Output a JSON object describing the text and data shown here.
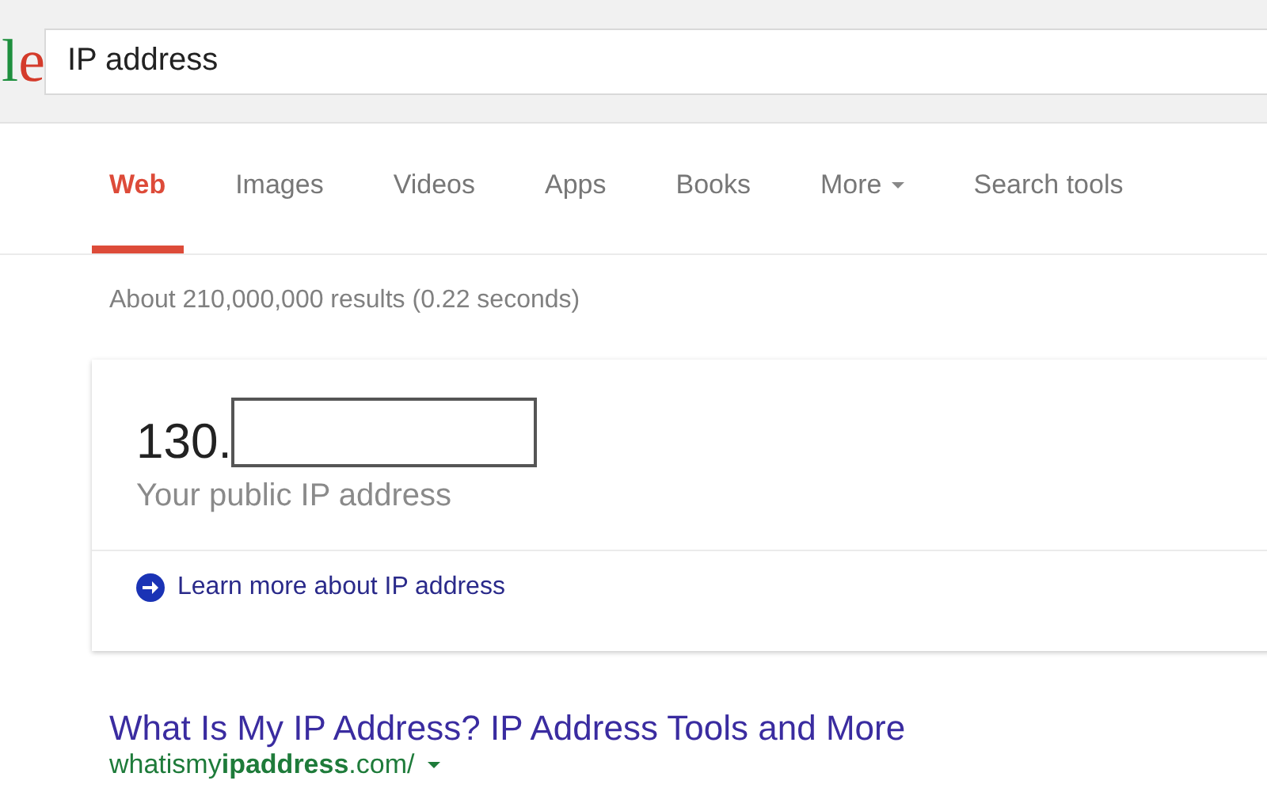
{
  "logo": {
    "letters": [
      {
        "text": "l",
        "color": "#1e8f3e"
      },
      {
        "text": "e",
        "color": "#d43b2b"
      }
    ]
  },
  "search": {
    "value": "IP address"
  },
  "tabs": [
    {
      "label": "Web",
      "selected": true,
      "kind": "plain"
    },
    {
      "label": "Images",
      "selected": false,
      "kind": "plain"
    },
    {
      "label": "Videos",
      "selected": false,
      "kind": "plain"
    },
    {
      "label": "Apps",
      "selected": false,
      "kind": "plain"
    },
    {
      "label": "Books",
      "selected": false,
      "kind": "plain"
    },
    {
      "label": "More",
      "selected": false,
      "kind": "dropdown"
    },
    {
      "label": "Search tools",
      "selected": false,
      "kind": "plain"
    }
  ],
  "result_stats": "About 210,000,000 results (0.22 seconds)",
  "answer_card": {
    "ip_prefix": "130.",
    "caption": "Your public IP address",
    "link": "Learn more about IP address"
  },
  "results": [
    {
      "title": "What Is My IP Address? IP Address Tools and More",
      "url": "whatismy**ipaddress**.com/"
    }
  ]
}
